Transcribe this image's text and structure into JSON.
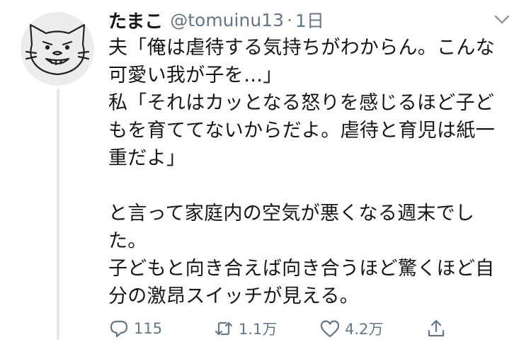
{
  "tweet": {
    "name": "たまこ",
    "handle": "@tomuinu13",
    "separator": "·",
    "time": "1日",
    "lines": [
      "夫「俺は虐待する気持ちがわからん。こんな",
      "可愛い我が子を…」",
      "私「それはカッとなる怒りを感じるほど子ど",
      "もを育ててないからだよ。虐待と育児は紙一",
      "重だよ」",
      "",
      "と言って家庭内の空気が悪くなる週末でし",
      "た。",
      "子どもと向き合えば向き合うほど驚くほど自",
      "分の激昂スイッチが見える。"
    ],
    "actions": {
      "reply_count": "115",
      "retweet_count": "1.1万",
      "like_count": "4.2万"
    }
  },
  "icons": {
    "avatar": "cat-drawing-avatar",
    "caret": "chevron-down-icon",
    "reply": "reply-icon",
    "retweet": "retweet-icon",
    "like": "heart-icon",
    "share": "share-icon"
  },
  "colors": {
    "text": "#14171a",
    "secondary": "#657786",
    "thread_line": "#e1e8ed"
  }
}
